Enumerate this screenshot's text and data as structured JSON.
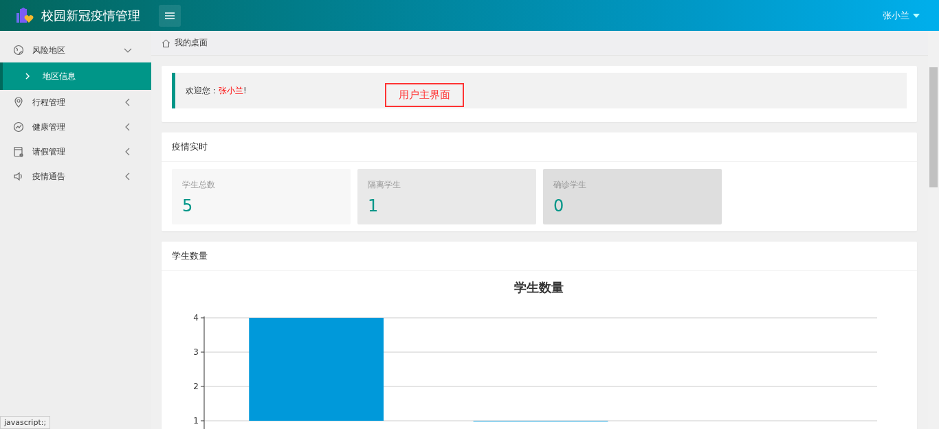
{
  "header": {
    "title": "校园新冠疫情管理",
    "user": "张小兰"
  },
  "sidebar": {
    "items": [
      {
        "label": "风险地区",
        "expanded": true,
        "children": [
          {
            "label": "地区信息",
            "selected": true
          }
        ]
      },
      {
        "label": "行程管理",
        "expanded": false
      },
      {
        "label": "健康管理",
        "expanded": false
      },
      {
        "label": "请假管理",
        "expanded": false
      },
      {
        "label": "疫情通告",
        "expanded": false
      }
    ]
  },
  "breadcrumb": "我的桌面",
  "welcome": {
    "label": "欢迎您：",
    "name": "张小兰",
    "suffix": "!",
    "note": "用户主界面"
  },
  "stats": {
    "title": "疫情实时",
    "cards": [
      {
        "label": "学生总数",
        "value": "5"
      },
      {
        "label": "隔离学生",
        "value": "1"
      },
      {
        "label": "确诊学生",
        "value": "0"
      }
    ]
  },
  "chart_panel": {
    "title": "学生数量",
    "chart_data": {
      "type": "bar",
      "title": "学生数量",
      "values": [
        4,
        1,
        null
      ],
      "ylim": [
        1,
        4
      ],
      "yticks": [
        1,
        2,
        3,
        4
      ]
    }
  },
  "status_bar": "javascript:;"
}
